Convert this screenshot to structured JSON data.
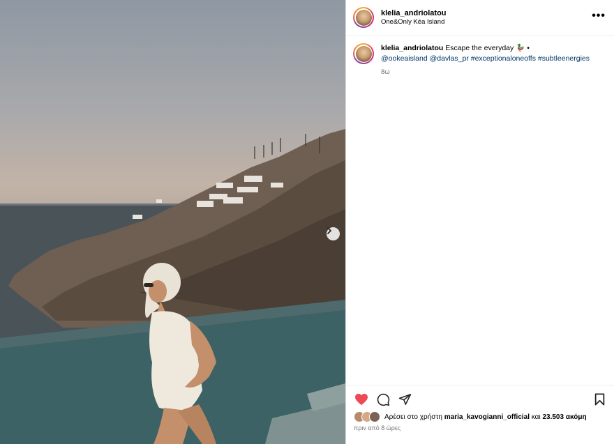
{
  "post": {
    "username": "klelia_andriolatou",
    "location": "One&Only Kéa Island",
    "more_label": "•••"
  },
  "caption": {
    "username": "klelia_andriolatou",
    "text": "Escape the everyday",
    "emoji": "🦆",
    "bullet": "•",
    "mention_1": "@ookeaisland",
    "mention_2": "@davlas_pr",
    "hashtag_1": "#exceptionaloneoffs",
    "hashtag_2": "#subtleenergies",
    "age": "8ω"
  },
  "likes": {
    "prefix": "Αρέσει στο χρήστη",
    "user": "maria_kavogianni_official",
    "connector": "και",
    "count": "23.503 ακόμη",
    "when": "πριν από 8 ώρες"
  },
  "icons": [
    "next-arrow-icon",
    "more-options-icon",
    "heart-icon",
    "comment-icon",
    "share-icon",
    "bookmark-icon"
  ],
  "colors": {
    "like": "#ed4956",
    "link": "#00376b",
    "muted": "#737373"
  }
}
